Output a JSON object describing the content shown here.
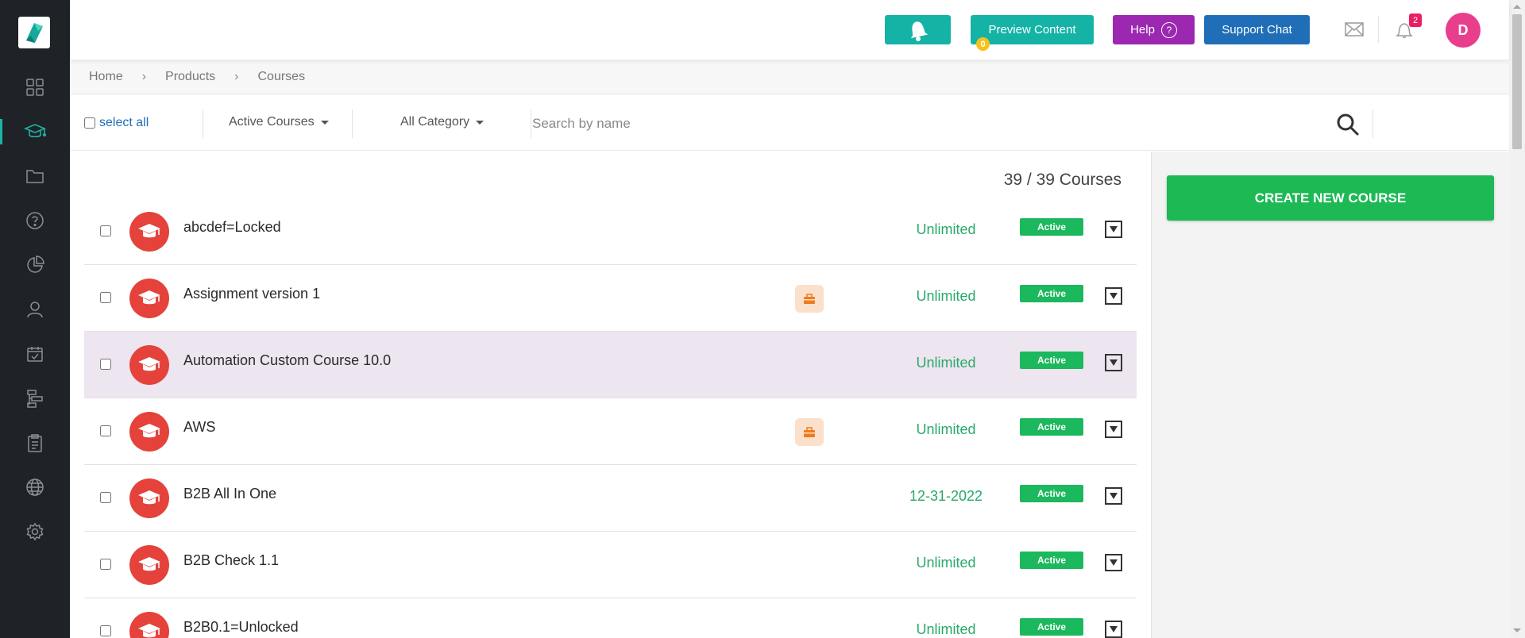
{
  "sidebar": {
    "logo": "app-logo",
    "items": [
      {
        "name": "dashboard",
        "icon": "grid-icon"
      },
      {
        "name": "courses",
        "icon": "graduation-cap-icon",
        "active": true
      },
      {
        "name": "folders",
        "icon": "folder-icon"
      },
      {
        "name": "help",
        "icon": "question-circle-icon"
      },
      {
        "name": "reports",
        "icon": "pie-chart-icon"
      },
      {
        "name": "users",
        "icon": "user-icon"
      },
      {
        "name": "calendar",
        "icon": "calendar-check-icon"
      },
      {
        "name": "sitemap",
        "icon": "sitemap-icon"
      },
      {
        "name": "assessments",
        "icon": "clipboard-list-icon"
      },
      {
        "name": "website",
        "icon": "globe-icon"
      },
      {
        "name": "settings",
        "icon": "gear-icon"
      }
    ]
  },
  "topbar": {
    "bell_count": "0",
    "preview_label": "Preview Content",
    "help_label": "Help",
    "help_icon": "?",
    "support_label": "Support Chat",
    "notification_count": "2",
    "avatar_initial": "D"
  },
  "breadcrumb": [
    "Home",
    "Products",
    "Courses"
  ],
  "filters": {
    "select_all": "select all",
    "status_filter": "Active Courses",
    "category_filter": "All Category",
    "search_placeholder": "Search by name"
  },
  "list": {
    "count_label": "39 / 39 Courses",
    "courses": [
      {
        "name": "abcdef=Locked",
        "validity": "Unlimited",
        "status": "Active",
        "assignment": false,
        "highlight": false
      },
      {
        "name": "Assignment version 1",
        "validity": "Unlimited",
        "status": "Active",
        "assignment": true,
        "highlight": false
      },
      {
        "name": "Automation Custom Course 10.0",
        "validity": "Unlimited",
        "status": "Active",
        "assignment": false,
        "highlight": true
      },
      {
        "name": "AWS",
        "validity": "Unlimited",
        "status": "Active",
        "assignment": true,
        "highlight": false
      },
      {
        "name": "B2B All In One",
        "validity": "12-31-2022",
        "status": "Active",
        "assignment": false,
        "highlight": false
      },
      {
        "name": "B2B Check 1.1",
        "validity": "Unlimited",
        "status": "Active",
        "assignment": false,
        "highlight": false
      },
      {
        "name": "B2B0.1=Unlocked",
        "validity": "Unlimited",
        "status": "Active",
        "assignment": false,
        "highlight": false
      }
    ]
  },
  "right_panel": {
    "create_label": "CREATE NEW COURSE"
  },
  "colors": {
    "sidebar_bg": "#1f2227",
    "accent_teal": "#15b3a6",
    "help_purple": "#9c27b0",
    "support_blue": "#1f6eb7",
    "course_icon_red": "#e4423a",
    "active_green": "#1cb85d",
    "validity_green": "#2aa96b",
    "create_green": "#1cb954"
  }
}
